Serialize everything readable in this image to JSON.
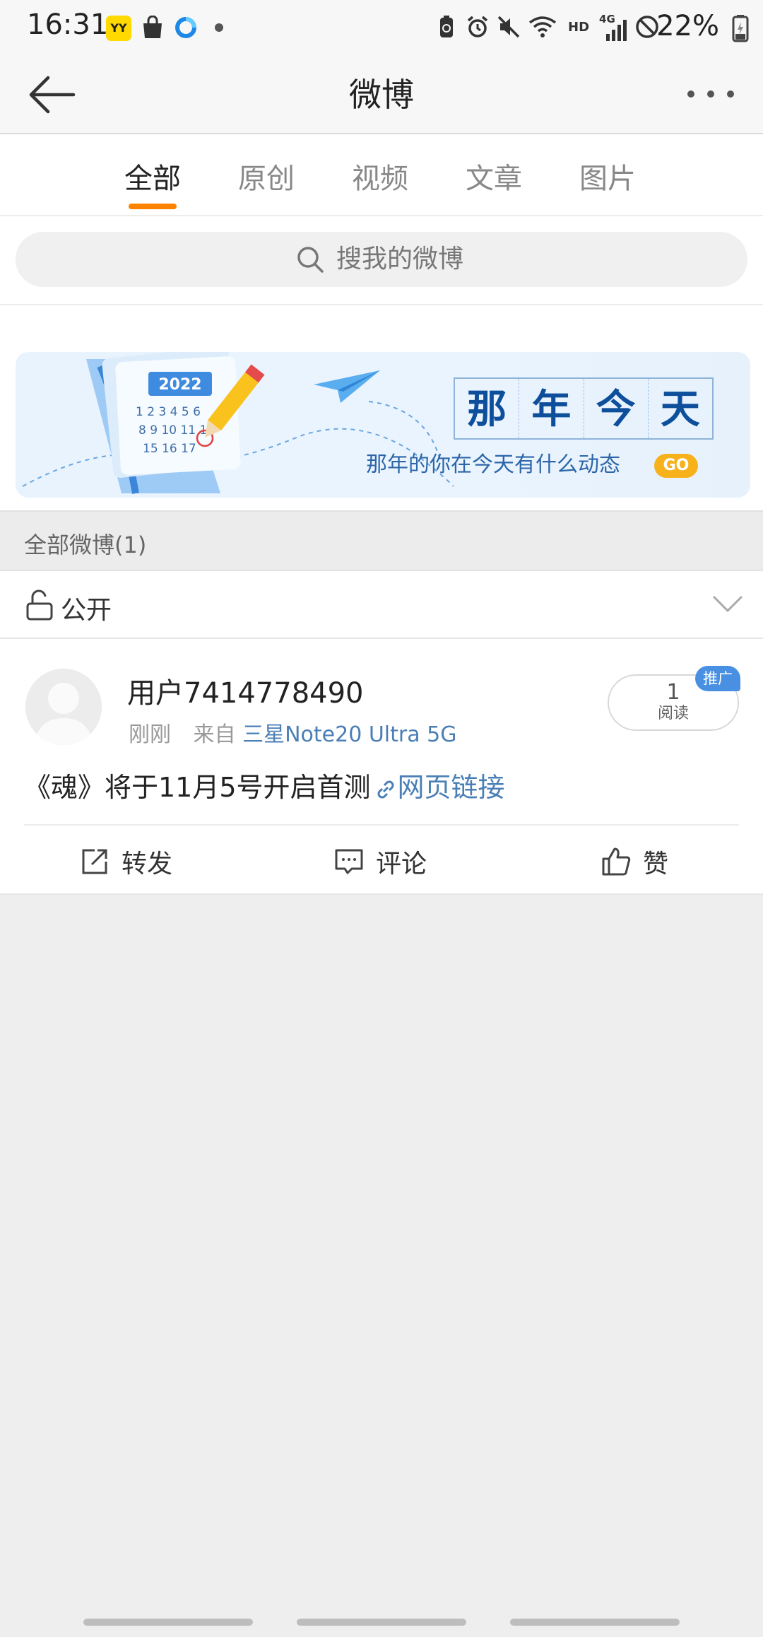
{
  "status_bar": {
    "time": "16:31",
    "yy_label": "YY",
    "network": "4G",
    "hd": "HD",
    "battery": "22%",
    "icons": [
      "yy-app-icon",
      "shopping-bag-icon",
      "browser-icon",
      "notification-dot",
      "battery-saver-icon",
      "alarm-icon",
      "mute-icon",
      "wifi-icon",
      "hd-icon",
      "signal-icon",
      "do-not-disturb-icon",
      "battery-icon"
    ]
  },
  "nav": {
    "title": "微博"
  },
  "tabs": [
    {
      "label": "全部",
      "active": true
    },
    {
      "label": "原创",
      "active": false
    },
    {
      "label": "视频",
      "active": false
    },
    {
      "label": "文章",
      "active": false
    },
    {
      "label": "图片",
      "active": false
    }
  ],
  "search": {
    "placeholder": "搜我的微博"
  },
  "banner": {
    "title_chars": [
      "那",
      "年",
      "今",
      "天"
    ],
    "subtitle": "那年的你在今天有什么动态",
    "go_label": "GO",
    "calendar_year": "2022"
  },
  "section": {
    "header": "全部微博(1)"
  },
  "filter": {
    "label": "公开"
  },
  "post": {
    "username": "用户7414778490",
    "time": "刚刚",
    "from_label": "来自",
    "source": "三星Note20 Ultra 5G",
    "read_count": "1",
    "read_label": "阅读",
    "promo_badge": "推广",
    "content": "《魂》将于11月5号开启首测",
    "link_text": "网页链接",
    "actions": {
      "repost": "转发",
      "comment": "评论",
      "like": "赞"
    }
  },
  "colors": {
    "accent_orange": "#ff8200",
    "link_blue": "#4a7fb5",
    "promo_blue": "#4a90e2",
    "banner_title_blue": "#0e4f9c",
    "go_yellow": "#f7b21b"
  }
}
